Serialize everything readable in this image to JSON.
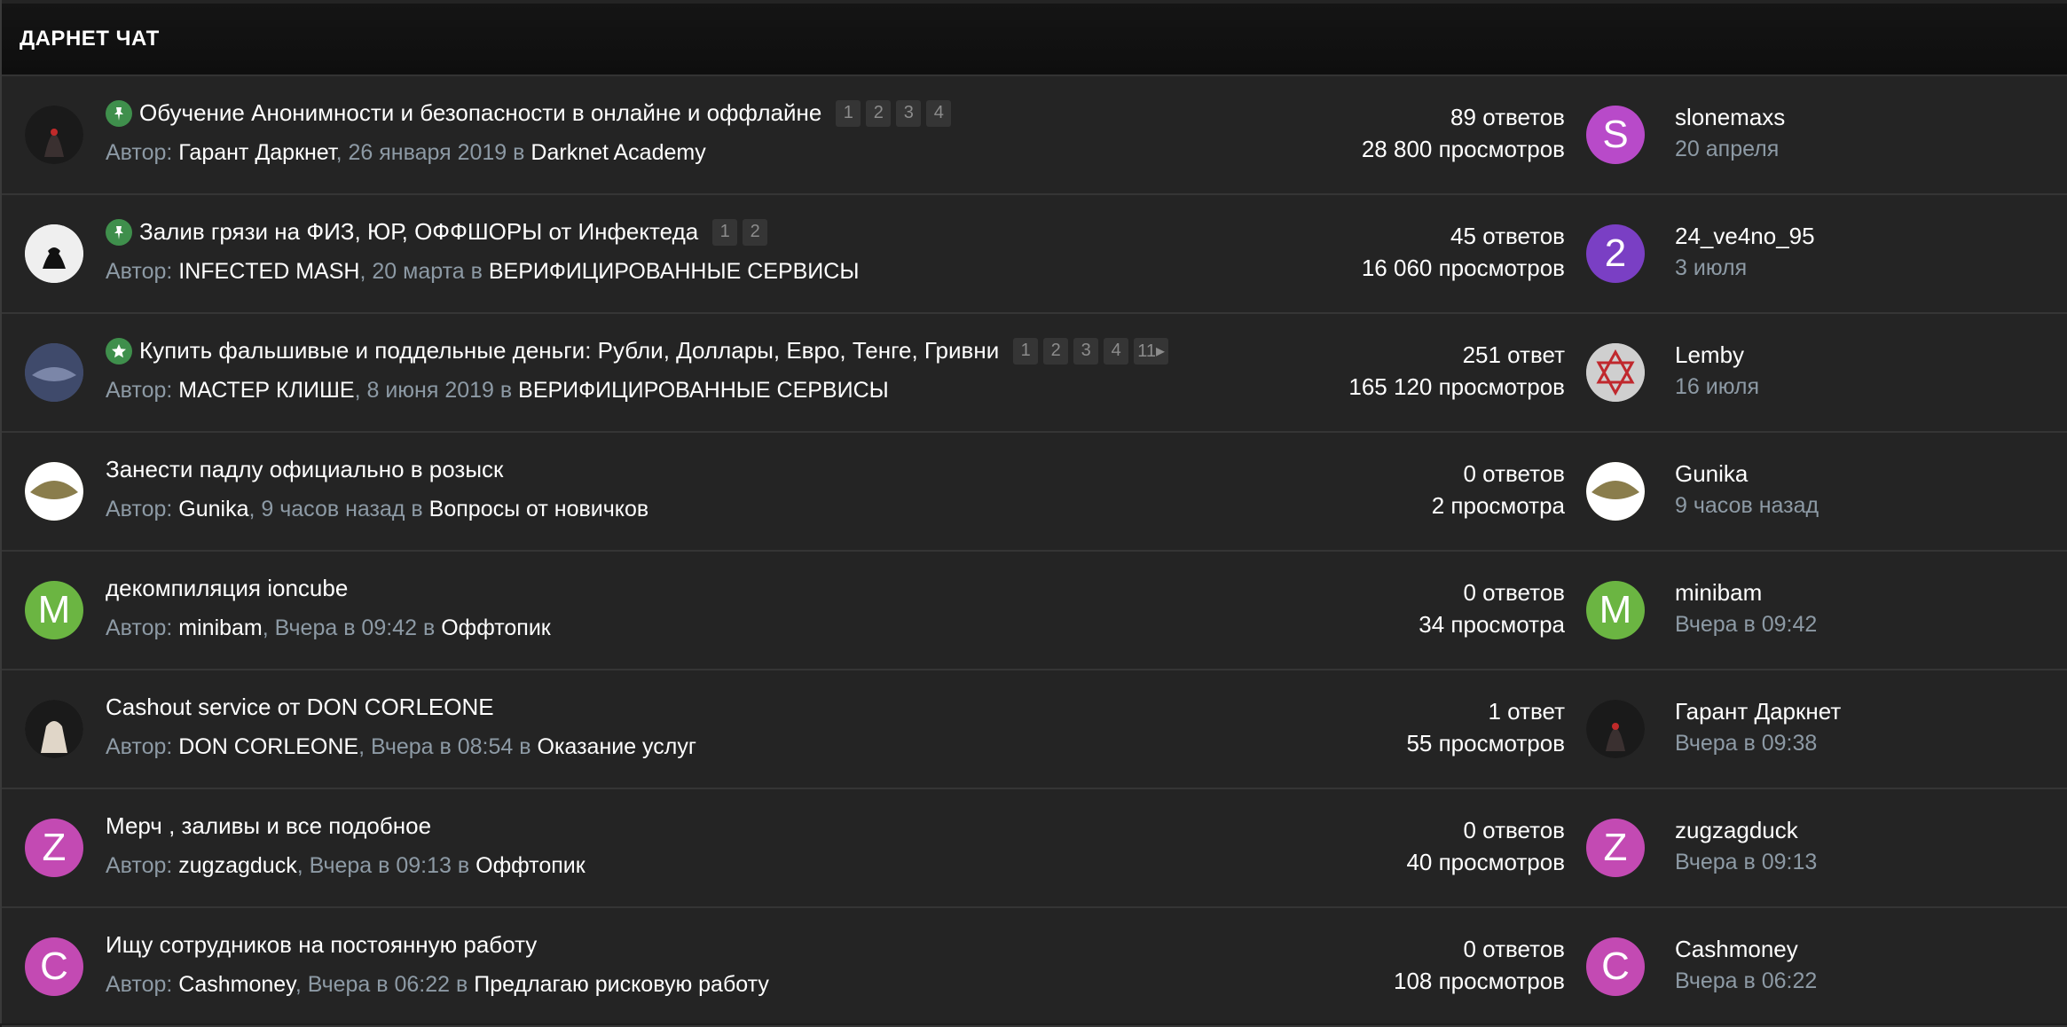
{
  "header": {
    "title": "ДАРНЕТ ЧАТ"
  },
  "labels": {
    "author_prefix": "Автор: ",
    "comma": ", ",
    "in": " в "
  },
  "threads": [
    {
      "title": "Обучение Анонимности и безопасности в онлайне и оффлайне",
      "pin": "pin-icon",
      "pages": [
        "1",
        "2",
        "3",
        "4"
      ],
      "author": "Гарант Даркнет",
      "date": "26 января 2019",
      "forum": "Darknet Academy",
      "replies": "89 ответов",
      "views": "28 800 просмотров",
      "last_user": "slonemaxs",
      "last_date": "20 апреля",
      "avatar_color": "#2b2b2b",
      "last_avatar": {
        "letter": "S",
        "color": "#b84ac9"
      }
    },
    {
      "title": "Залив грязи на ФИЗ, ЮР, ОФФШОРЫ от Инфектеда",
      "pin": "pin-icon",
      "pages": [
        "1",
        "2"
      ],
      "author": "INFECTED MASH",
      "date": "20 марта",
      "forum": "ВЕРИФИЦИРОВАННЫЕ СЕРВИСЫ",
      "replies": "45 ответов",
      "views": "16 060 просмотров",
      "last_user": "24_ve4no_95",
      "last_date": "3 июля",
      "avatar_color": "#e8e8e8",
      "last_avatar": {
        "letter": "2",
        "color": "#7a3fc4"
      }
    },
    {
      "title": "Купить фальшивые и поддельные деньги: Рубли, Доллары, Евро, Тенге, Гривни",
      "pin": "star-icon",
      "pages": [
        "1",
        "2",
        "3",
        "4",
        "11▸"
      ],
      "author": "МАСТЕР КЛИШЕ",
      "date": "8 июня 2019",
      "forum": "ВЕРИФИЦИРОВАННЫЕ СЕРВИСЫ",
      "replies": "251 ответ",
      "views": "165 120 просмотров",
      "last_user": "Lemby",
      "last_date": "16 июля",
      "avatar_color": "#4a5575",
      "last_avatar": {
        "letter": "",
        "color": "#c9c9c9"
      }
    },
    {
      "title": "Занести падлу официально в розыск",
      "pin": "",
      "pages": [],
      "author": "Gunika",
      "date": "9 часов назад",
      "forum": "Вопросы от новичков",
      "replies": "0 ответов",
      "views": "2 просмотра",
      "last_user": "Gunika",
      "last_date": "9 часов назад",
      "avatar_color": "#8a8458",
      "last_avatar": {
        "letter": "",
        "color": "#8a8458"
      }
    },
    {
      "title": "декомпиляция ioncube",
      "pin": "",
      "pages": [],
      "author": "minibam",
      "date": "Вчера в 09:42",
      "forum": "Оффтопик",
      "replies": "0 ответов",
      "views": "34 просмотра",
      "last_user": "minibam",
      "last_date": "Вчера в 09:42",
      "avatar_letter": "M",
      "avatar_color": "#6bb542",
      "last_avatar": {
        "letter": "M",
        "color": "#6bb542"
      }
    },
    {
      "title": "Cashout service от DON CORLEONE",
      "pin": "",
      "pages": [],
      "author": "DON CORLEONE",
      "date": "Вчера в 08:54",
      "forum": "Оказание услуг",
      "replies": "1 ответ",
      "views": "55 просмотров",
      "last_user": "Гарант Даркнет",
      "last_date": "Вчера в 09:38",
      "avatar_color": "#3a3a3a",
      "last_avatar": {
        "letter": "",
        "color": "#2b2b2b"
      }
    },
    {
      "title": "Мерч , заливы и все подобное",
      "pin": "",
      "pages": [],
      "author": "zugzagduck",
      "date": "Вчера в 09:13",
      "forum": "Оффтопик",
      "replies": "0 ответов",
      "views": "40 просмотров",
      "last_user": "zugzagduck",
      "last_date": "Вчера в 09:13",
      "avatar_letter": "Z",
      "avatar_color": "#c34ab3",
      "last_avatar": {
        "letter": "Z",
        "color": "#c34ab3"
      }
    },
    {
      "title": "Ищу сотрудников на постоянную работу",
      "pin": "",
      "pages": [],
      "author": "Cashmoney",
      "date": "Вчера в 06:22",
      "forum": "Предлагаю рисковую работу",
      "replies": "0 ответов",
      "views": "108 просмотров",
      "last_user": "Cashmoney",
      "last_date": "Вчера в 06:22",
      "avatar_letter": "C",
      "avatar_color": "#c34ab3",
      "last_avatar": {
        "letter": "C",
        "color": "#c34ab3"
      }
    }
  ]
}
